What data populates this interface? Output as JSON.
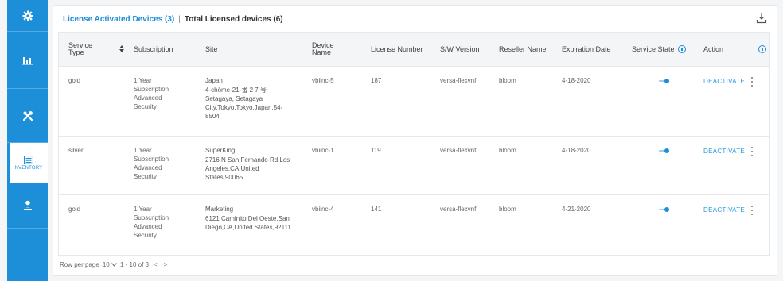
{
  "sidebar": {
    "items": [
      {
        "name": "settings",
        "icon": "gear-icon",
        "label": ""
      },
      {
        "name": "analytics",
        "icon": "bar-chart-icon",
        "label": ""
      },
      {
        "name": "tools",
        "icon": "tools-icon",
        "label": ""
      },
      {
        "name": "inventory",
        "icon": "inventory-icon",
        "label": "NVENTORY"
      },
      {
        "name": "users",
        "icon": "user-icon",
        "label": ""
      }
    ],
    "active_color": "#1d8ed8"
  },
  "header": {
    "activated_tab": "License Activated Devices (3)",
    "separator": "|",
    "total_tab": "Total Licensed devices (6)"
  },
  "table": {
    "columns": {
      "service_type": "Service Type",
      "subscription": "Subscription",
      "site": "Site",
      "device_name": "Device Name",
      "license_number": "License Number",
      "sw_version": "S/W Version",
      "reseller_name": "Reseller Name",
      "expiration_date": "Expiration Date",
      "service_state": "Service State",
      "action": "Action"
    },
    "rows": [
      {
        "service_type": "gold",
        "subscription": [
          "1 Year",
          "Subscription",
          "Advanced",
          "Security"
        ],
        "site_name": "Japan",
        "site_address": [
          "4-chōme-21-番 2 7 号",
          "Setagaya, Setagaya",
          "City,Tokyo,Tokyo,Japan,54-",
          "8504"
        ],
        "device_name": "vbiinc-5",
        "license_number": "187",
        "sw_version": "versa-flexvnf",
        "reseller_name": "bloom",
        "expiration_date": "4-18-2020",
        "service_state": "on",
        "action": "DEACTIVATE"
      },
      {
        "service_type": "silver",
        "subscription": [
          "1 Year",
          "Subscription",
          "Advanced",
          "Security"
        ],
        "site_name": "SuperKing",
        "site_address": [
          "2716 N San Fernando Rd,Los",
          "Angeles,CA,United",
          "States,90065"
        ],
        "device_name": "vbiinc-1",
        "license_number": "119",
        "sw_version": "versa-flexvnf",
        "reseller_name": "bloom",
        "expiration_date": "4-18-2020",
        "service_state": "on",
        "action": "DEACTIVATE"
      },
      {
        "service_type": "gold",
        "subscription": [
          "1 Year",
          "Subscription",
          "Advanced",
          "Security"
        ],
        "site_name": "Marketing",
        "site_address": [
          "6121 Caminito Del Oeste,San",
          "Diego,CA,United States,92111"
        ],
        "device_name": "vbiinc-4",
        "license_number": "141",
        "sw_version": "versa-flexvnf",
        "reseller_name": "bloom",
        "expiration_date": "4-21-2020",
        "service_state": "on",
        "action": "DEACTIVATE"
      }
    ]
  },
  "footer": {
    "rows_per_page_label": "Row per page",
    "rows_per_page_value": "10",
    "range": "1 - 10 of 3",
    "prev": "<",
    "next": ">"
  },
  "colors": {
    "accent": "#1d8ed8",
    "link": "#2a9be0"
  }
}
